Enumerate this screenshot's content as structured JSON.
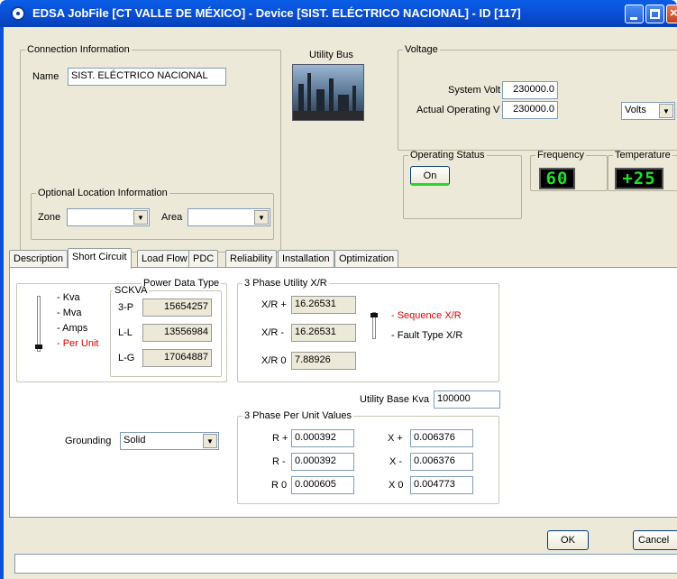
{
  "window": {
    "title": "EDSA JobFile [CT VALLE DE MÉXICO] - Device [SIST. ELÉCTRICO NACIONAL] - ID [117]"
  },
  "connection": {
    "legend": "Connection Information",
    "name_label": "Name",
    "name_value": "SIST. ELÉCTRICO NACIONAL",
    "optional_legend": "Optional Location Information",
    "zone_label": "Zone",
    "zone_value": "",
    "area_label": "Area",
    "area_value": ""
  },
  "utility_bus": {
    "label": "Utility Bus"
  },
  "voltage": {
    "legend": "Voltage",
    "system_volt_label": "System Volt",
    "system_volt_value": "230000.0",
    "actual_label": "Actual Operating V",
    "actual_value": "230000.0",
    "unit_value": "Volts"
  },
  "operating_status": {
    "legend": "Operating Status",
    "button_label": "On"
  },
  "frequency": {
    "legend": "Frequency",
    "value": "60"
  },
  "temperature": {
    "legend": "Temperature",
    "value": "+25"
  },
  "tabs": [
    {
      "label": "Description"
    },
    {
      "label": "Short Circuit"
    },
    {
      "label": "Load Flow"
    },
    {
      "label": "PDC"
    },
    {
      "label": "Reliability"
    },
    {
      "label": "Installation"
    },
    {
      "label": "Optimization"
    }
  ],
  "power_data": {
    "legend": "Power Data Type",
    "options": [
      "- Kva",
      "- Mva",
      "- Amps",
      "- Per Unit"
    ],
    "selected": "- Per Unit",
    "sckva_legend": "SCKVA",
    "rows": [
      {
        "label": "3-P",
        "value": "15654257"
      },
      {
        "label": "L-L",
        "value": "13556984"
      },
      {
        "label": "L-G",
        "value": "17064887"
      }
    ]
  },
  "utility_xr": {
    "legend": "3 Phase Utility X/R",
    "rows": [
      {
        "label": "X/R +",
        "value": "16.26531"
      },
      {
        "label": "X/R -",
        "value": "16.26531"
      },
      {
        "label": "X/R 0",
        "value": "7.88926"
      }
    ],
    "options": [
      "- Sequence X/R",
      "- Fault Type X/R"
    ]
  },
  "base_kva": {
    "label": "Utility Base Kva",
    "value": "100000"
  },
  "grounding": {
    "label": "Grounding",
    "value": "Solid"
  },
  "per_unit": {
    "legend": "3 Phase Per Unit Values",
    "r_plus_label": "R +",
    "r_plus": "0.000392",
    "r_minus_label": "R -",
    "r_minus": "0.000392",
    "r0_label": "R 0",
    "r0": "0.000605",
    "x_plus_label": "X +",
    "x_plus": "0.006376",
    "x_minus_label": "X -",
    "x_minus": "0.006376",
    "x0_label": "X 0",
    "x0": "0.004773"
  },
  "footer": {
    "ok_label": "OK",
    "cancel_label": "Cancel"
  }
}
